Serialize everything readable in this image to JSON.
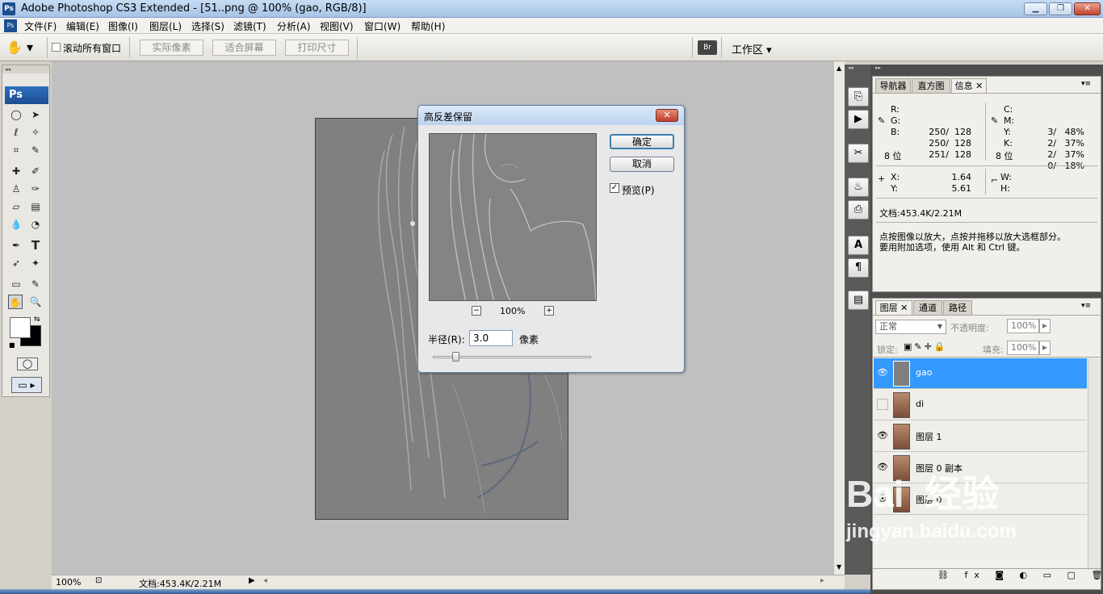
{
  "window": {
    "title": "Adobe Photoshop CS3 Extended - [51..png @ 100% (gao, RGB/8)]",
    "app_icon": "Ps"
  },
  "menu": [
    "文件(F)",
    "编辑(E)",
    "图像(I)",
    "图层(L)",
    "选择(S)",
    "滤镜(T)",
    "分析(A)",
    "视图(V)",
    "窗口(W)",
    "帮助(H)"
  ],
  "options_bar": {
    "scroll_all": "滚动所有窗口",
    "actual_pixels": "实际像素",
    "fit_screen": "适合屏幕",
    "print_size": "打印尺寸",
    "workspace": "工作区 ▾"
  },
  "toolbox": {
    "logo": "Ps"
  },
  "status": {
    "zoom": "100%",
    "doc": "文档:453.4K/2.21M"
  },
  "dialog": {
    "title": "高反差保留",
    "ok": "确定",
    "cancel": "取消",
    "preview_label": "预览(P)",
    "preview_checked": true,
    "zoom": "100%",
    "radius_label": "半径(R):",
    "radius_value": "3.0",
    "radius_unit": "像素",
    "slider_fraction": 0.12
  },
  "info_panel": {
    "tabs": [
      "导航器",
      "直方图",
      "信息"
    ],
    "rgb": [
      {
        "label": "R:",
        "value": "250/  128"
      },
      {
        "label": "G:",
        "value": "250/  128"
      },
      {
        "label": "B:",
        "value": "251/  128"
      }
    ],
    "cmyk": [
      {
        "label": "C:",
        "value": "3/   48%"
      },
      {
        "label": "M:",
        "value": "2/   37%"
      },
      {
        "label": "Y:",
        "value": "2/   37%"
      },
      {
        "label": "K:",
        "value": "0/   18%"
      }
    ],
    "bits_left": "8 位",
    "bits_right": "8 位",
    "x_label": "X:",
    "x_value": "1.64",
    "y_label": "Y:",
    "y_value": "5.61",
    "w_label": "W:",
    "h_label": "H:",
    "doc": "文档:453.4K/2.21M",
    "hint_line1": "点按图像以放大，点按并拖移以放大选框部分。",
    "hint_line2": "要用附加选项，使用 Alt 和 Ctrl 键。"
  },
  "layers_panel": {
    "tabs": [
      "图层",
      "通道",
      "路径"
    ],
    "blend_mode": "正常",
    "opacity_label": "不透明度:",
    "opacity_value": "100%",
    "lock_label": "锁定:",
    "fill_label": "填充:",
    "fill_value": "100%",
    "layers": [
      {
        "name": "gao",
        "visible": true,
        "selected": true,
        "thumb": "gray"
      },
      {
        "name": "di",
        "visible": false,
        "selected": false,
        "thumb": "photo"
      },
      {
        "name": "图层 1",
        "visible": true,
        "selected": false,
        "thumb": "photo"
      },
      {
        "name": "图层 0 副本",
        "visible": true,
        "selected": false,
        "thumb": "photo"
      },
      {
        "name": "图层 0",
        "visible": true,
        "selected": false,
        "thumb": "photo"
      }
    ]
  },
  "watermark": {
    "brand": "Bai  经验",
    "url": "jingyan.baidu.com"
  },
  "colors": {
    "selection": "#3399ff",
    "canvas_bg": "#c0c0c0",
    "panel_dark": "#4d4d4d"
  }
}
